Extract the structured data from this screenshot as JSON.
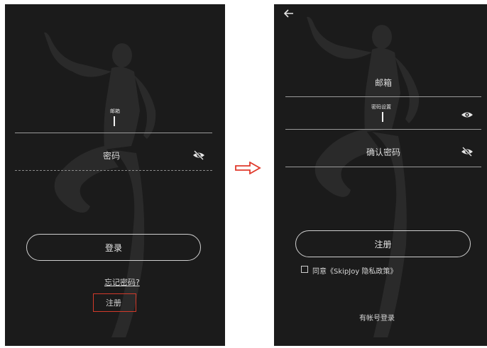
{
  "login": {
    "email_label": "邮箱",
    "password_placeholder": "密码",
    "login_button": "登录",
    "forgot_password": "忘记密码?",
    "register_link": "注册"
  },
  "register": {
    "email_placeholder": "邮箱",
    "password_label": "密码设置",
    "confirm_password_placeholder": "确认密码",
    "register_button": "注册",
    "agree_text": "同意《SkipJoy 隐私政策》",
    "login_link": "有帐号登录"
  },
  "colors": {
    "screen_bg": "#1b1b1b",
    "highlight_box": "#d23a2a",
    "arrow": "#e0392b"
  },
  "icons": {
    "password_visibility_login": "eye-off-icon",
    "password_visibility_register": "eye-icon",
    "confirm_visibility_register": "eye-off-icon",
    "back": "back-arrow-icon",
    "transition": "right-arrow-icon"
  }
}
